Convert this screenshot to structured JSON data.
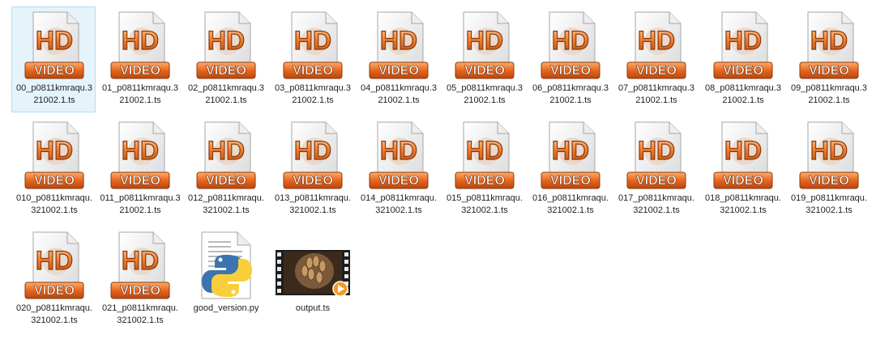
{
  "window": {
    "view": "explorer-large-icons"
  },
  "colors": {
    "selection_bg": "#e5f3fb",
    "selection_border": "#b8d9f1",
    "hd_orange": "#f07a28",
    "video_band": "#e7661e",
    "python_blue": "#3b74b0",
    "python_yellow": "#f8cf3b"
  },
  "files": [
    {
      "name": "00_p0811kmraqu.321002.1.ts",
      "icon": "hd-video-icon",
      "selected": true
    },
    {
      "name": "01_p0811kmraqu.321002.1.ts",
      "icon": "hd-video-icon"
    },
    {
      "name": "02_p0811kmraqu.321002.1.ts",
      "icon": "hd-video-icon"
    },
    {
      "name": "03_p0811kmraqu.321002.1.ts",
      "icon": "hd-video-icon"
    },
    {
      "name": "04_p0811kmraqu.321002.1.ts",
      "icon": "hd-video-icon"
    },
    {
      "name": "05_p0811kmraqu.321002.1.ts",
      "icon": "hd-video-icon"
    },
    {
      "name": "06_p0811kmraqu.321002.1.ts",
      "icon": "hd-video-icon"
    },
    {
      "name": "07_p0811kmraqu.321002.1.ts",
      "icon": "hd-video-icon"
    },
    {
      "name": "08_p0811kmraqu.321002.1.ts",
      "icon": "hd-video-icon"
    },
    {
      "name": "09_p0811kmraqu.321002.1.ts",
      "icon": "hd-video-icon"
    },
    {
      "name": "010_p0811kmraqu.321002.1.ts",
      "icon": "hd-video-icon"
    },
    {
      "name": "011_p0811kmraqu.321002.1.ts",
      "icon": "hd-video-icon"
    },
    {
      "name": "012_p0811kmraqu.321002.1.ts",
      "icon": "hd-video-icon"
    },
    {
      "name": "013_p0811kmraqu.321002.1.ts",
      "icon": "hd-video-icon"
    },
    {
      "name": "014_p0811kmraqu.321002.1.ts",
      "icon": "hd-video-icon"
    },
    {
      "name": "015_p0811kmraqu.321002.1.ts",
      "icon": "hd-video-icon"
    },
    {
      "name": "016_p0811kmraqu.321002.1.ts",
      "icon": "hd-video-icon"
    },
    {
      "name": "017_p0811kmraqu.321002.1.ts",
      "icon": "hd-video-icon"
    },
    {
      "name": "018_p0811kmraqu.321002.1.ts",
      "icon": "hd-video-icon"
    },
    {
      "name": "019_p0811kmraqu.321002.1.ts",
      "icon": "hd-video-icon"
    },
    {
      "name": "020_p0811kmraqu.321002.1.ts",
      "icon": "hd-video-icon"
    },
    {
      "name": "021_p0811kmraqu.321002.1.ts",
      "icon": "hd-video-icon"
    },
    {
      "name": "good_version.py",
      "icon": "python-file-icon"
    },
    {
      "name": "output.ts",
      "icon": "video-thumbnail-icon"
    }
  ],
  "icon_text": {
    "hd": "HD",
    "video": "VIDEO"
  }
}
